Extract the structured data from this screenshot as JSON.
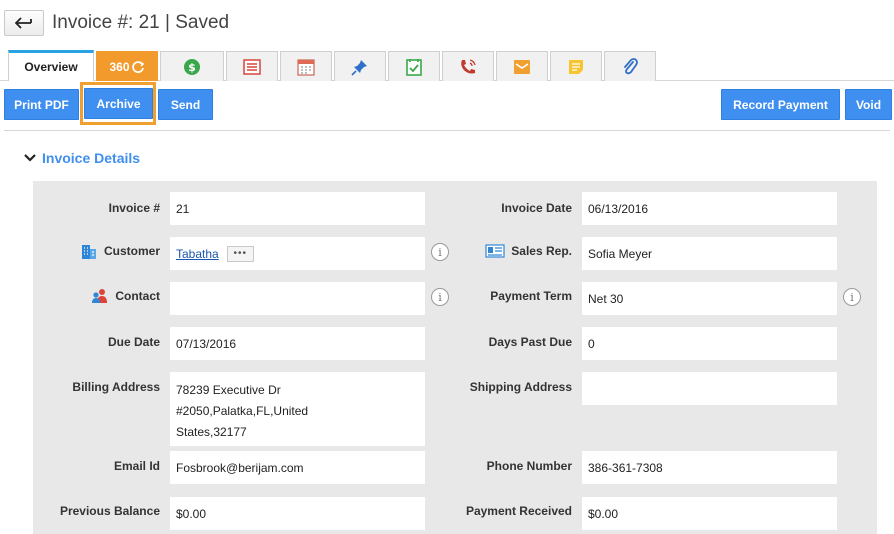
{
  "header": {
    "title": "Invoice #: 21 | Saved"
  },
  "tabs": [
    {
      "label": "Overview",
      "icon": ""
    },
    {
      "label": "360",
      "icon": "refresh-icon"
    },
    {
      "label": "",
      "icon": "dollar-refresh-icon"
    },
    {
      "label": "",
      "icon": "invoice-list-icon"
    },
    {
      "label": "",
      "icon": "calendar-icon"
    },
    {
      "label": "",
      "icon": "pin-icon"
    },
    {
      "label": "",
      "icon": "checklist-icon"
    },
    {
      "label": "",
      "icon": "phone-icon"
    },
    {
      "label": "",
      "icon": "email-icon"
    },
    {
      "label": "",
      "icon": "note-icon"
    },
    {
      "label": "",
      "icon": "paperclip-icon"
    }
  ],
  "toolbar": {
    "print_pdf": "Print PDF",
    "archive": "Archive",
    "send": "Send",
    "record_payment": "Record Payment",
    "void": "Void"
  },
  "section": {
    "title": "Invoice Details"
  },
  "fields": {
    "invoice_no": {
      "label": "Invoice #",
      "value": "21"
    },
    "invoice_date": {
      "label": "Invoice Date",
      "value": "06/13/2016"
    },
    "customer": {
      "label": "Customer",
      "value": "Tabatha",
      "more": "•••"
    },
    "sales_rep": {
      "label": "Sales Rep.",
      "value": "Sofia Meyer"
    },
    "contact": {
      "label": "Contact",
      "value": ""
    },
    "payment_term": {
      "label": "Payment Term",
      "value": "Net 30"
    },
    "due_date": {
      "label": "Due Date",
      "value": "07/13/2016"
    },
    "days_past_due": {
      "label": "Days Past Due",
      "value": "0"
    },
    "billing_address": {
      "label": "Billing Address",
      "lines": [
        "78239 Executive Dr",
        "#2050,Palatka,FL,United",
        "States,32177"
      ]
    },
    "shipping_address": {
      "label": "Shipping Address",
      "value": ""
    },
    "email": {
      "label": "Email Id",
      "value": "Fosbrook@berijam.com"
    },
    "phone": {
      "label": "Phone Number",
      "value": "386-361-7308"
    },
    "previous_balance": {
      "label": "Previous Balance",
      "value": "$0.00"
    },
    "payment_received": {
      "label": "Payment Received",
      "value": "$0.00"
    }
  },
  "colors": {
    "accent": "#3f8ff0",
    "tab_360": "#f39a2d",
    "highlight": "#f0a030",
    "active_tab_border": "#29a3e5"
  }
}
